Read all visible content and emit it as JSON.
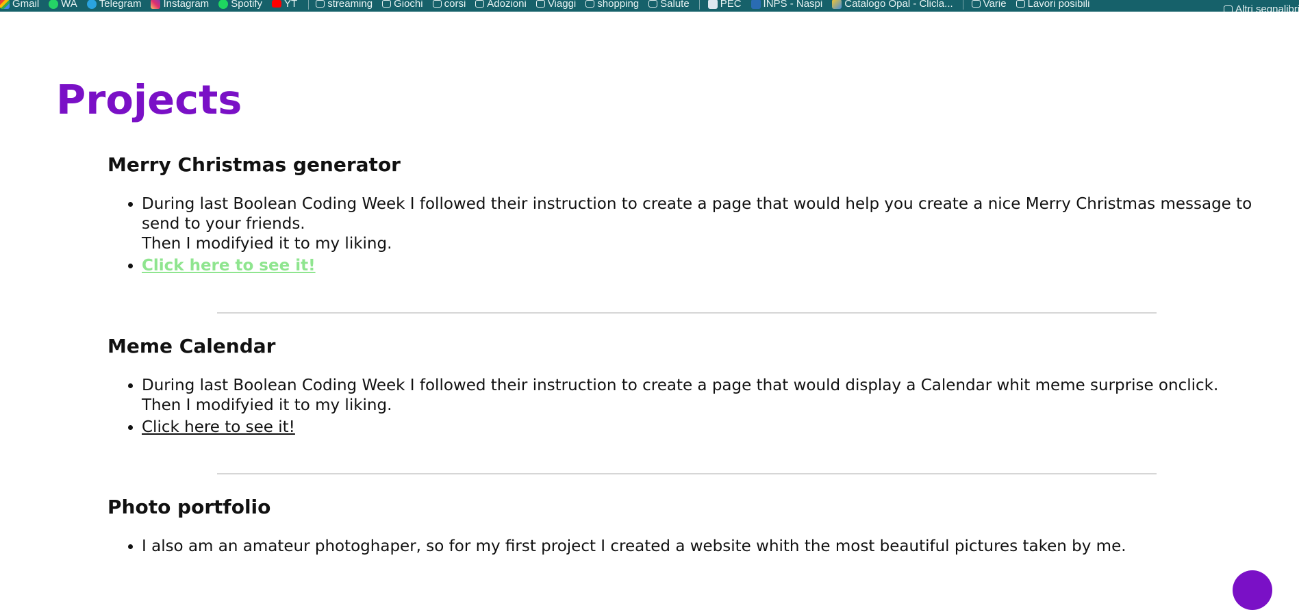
{
  "bookmarks": {
    "items": [
      {
        "label": "Gmail",
        "icon": "gmail-icon",
        "color": "#ea4335"
      },
      {
        "label": "WA",
        "icon": "whatsapp-icon",
        "color": "#25d366"
      },
      {
        "label": "Telegram",
        "icon": "telegram-icon",
        "color": "#2aa3df"
      },
      {
        "label": "Instagram",
        "icon": "instagram-icon",
        "color": "#e1306c"
      },
      {
        "label": "Spotify",
        "icon": "spotify-icon",
        "color": "#1ed760"
      },
      {
        "label": "YT",
        "icon": "youtube-icon",
        "color": "#ff0000"
      },
      {
        "label": "streaming",
        "icon": "folder-icon"
      },
      {
        "label": "Giochi",
        "icon": "folder-icon"
      },
      {
        "label": "corsi",
        "icon": "folder-icon"
      },
      {
        "label": "Adozioni",
        "icon": "folder-icon"
      },
      {
        "label": "Viaggi",
        "icon": "folder-icon"
      },
      {
        "label": "shopping",
        "icon": "folder-icon"
      },
      {
        "label": "Salute",
        "icon": "folder-icon"
      },
      {
        "label": "PEC",
        "icon": "pec-icon"
      },
      {
        "label": "INPS - Naspi",
        "icon": "inps-icon"
      },
      {
        "label": "Catalogo Opal - Clicla...",
        "icon": "opal-icon"
      },
      {
        "label": "Varie",
        "icon": "folder-icon"
      },
      {
        "label": "Lavori posibili",
        "icon": "folder-icon"
      },
      {
        "label": "Altri segnalibri",
        "icon": "folder-icon"
      }
    ]
  },
  "page": {
    "title": "Projects",
    "accent_color": "#7a10c6"
  },
  "projects": [
    {
      "title": "Merry Christmas generator",
      "description": "During last Boolean Coding Week I followed their instruction to create a page that would help you create a nice Merry Christmas message to send to your friends.",
      "note": "Then I modifyied it to my liking.",
      "link_label": "Click here to see it!"
    },
    {
      "title": "Meme Calendar",
      "description": "During last Boolean Coding Week I followed their instruction to create a page that would display a Calendar whit meme surprise onclick.",
      "note": "Then I modifyied it to my liking.",
      "link_label": "Click here to see it!"
    },
    {
      "title": "Photo portfolio",
      "description": "I also am an amateur photoghaper, so for my first project I created a website whith the most beautiful pictures taken by me."
    }
  ]
}
